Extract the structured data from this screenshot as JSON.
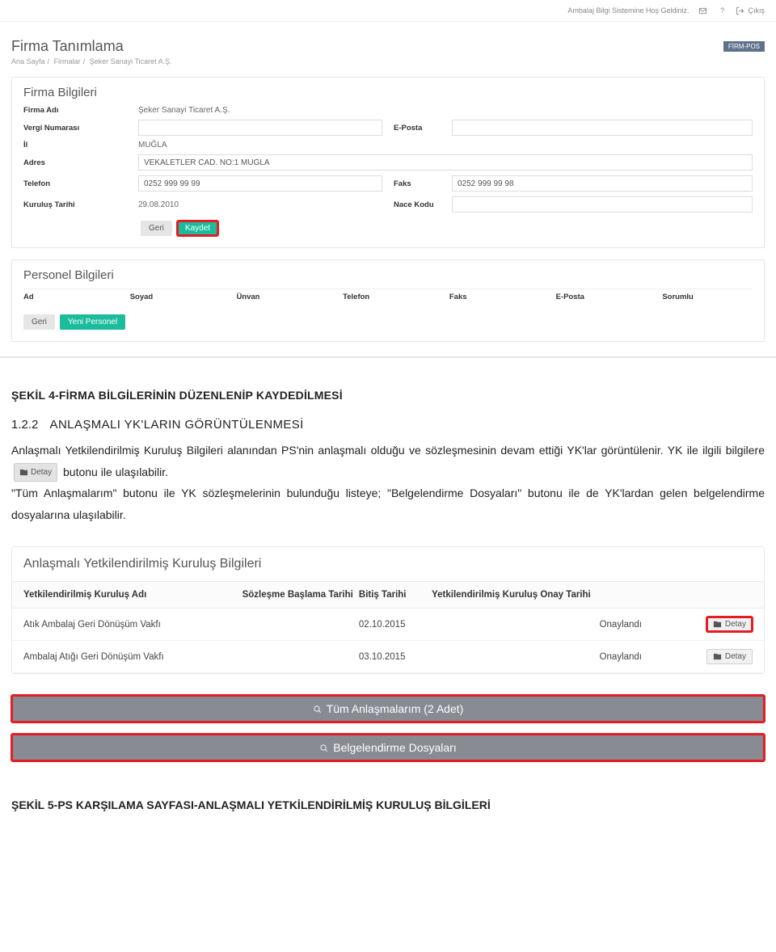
{
  "topbar": {
    "welcome": "Ambalaj Bilgi Sistemine Hoş Geldiniz.",
    "logout": "Çıkış"
  },
  "page": {
    "title": "Firma Tanımlama",
    "breadcrumb": [
      "Ana Sayfa",
      "Firmalar",
      "Şeker Sanayi Ticaret A.Ş."
    ],
    "badge": "FİRM-POS"
  },
  "firm_panel": {
    "title": "Firma Bilgileri",
    "fields": {
      "firma_adi_lbl": "Firma Adı",
      "firma_adi_val": "Şeker Sanayi Ticaret A.Ş.",
      "vergi_lbl": "Vergi Numarası",
      "vergi_val": "",
      "eposta_lbl": "E-Posta",
      "eposta_val": "",
      "il_lbl": "İl",
      "il_val": "MUĞLA",
      "adres_lbl": "Adres",
      "adres_val": "VEKALETLER CAD. NO:1 MUĞLA",
      "telefon_lbl": "Telefon",
      "telefon_val": "0252 999 99 99",
      "faks_lbl": "Faks",
      "faks_val": "0252 999 99 98",
      "kurulus_lbl": "Kuruluş Tarihi",
      "kurulus_val": "29.08.2010",
      "nace_lbl": "Nace Kodu",
      "nace_val": ""
    },
    "buttons": {
      "geri": "Geri",
      "kaydet": "Kaydet"
    }
  },
  "personnel_panel": {
    "title": "Personel Bilgileri",
    "head": {
      "ad": "Ad",
      "soyad": "Soyad",
      "unvan": "Ünvan",
      "telefon": "Telefon",
      "faks": "Faks",
      "eposta": "E-Posta",
      "sorumlu": "Sorumlu"
    },
    "buttons": {
      "geri": "Geri",
      "yeni": "Yeni Personel"
    }
  },
  "captions": {
    "fig4": "ŞEKİL 4-FİRMA BİLGİLERİNİN DÜZENLENİP KAYDEDİLMESİ",
    "fig5": "ŞEKİL 5-PS KARŞILAMA SAYFASI-ANLAŞMALI YETKİLENDİRİLMİŞ KURULUŞ BİLGİLERİ"
  },
  "section": {
    "number": "1.2.2",
    "title": "ANLAŞMALI YK'LARIN GÖRÜNTÜLENMESİ",
    "para_1a": "Anlaşmalı Yetkilendirilmiş Kuruluş Bilgileri alanından PS'nin anlaşmalı olduğu ve sözleşmesinin devam ettiği YK'lar görüntülenir. YK ile ilgili bilgilere",
    "para_1b": "butonu ile ulaşılabilir.",
    "inline_btn": "Detay",
    "para_2": "\"Tüm Anlaşmalarım\" butonu ile YK sözleşmelerinin bulunduğu listeye; \"Belgelendirme Dosyaları\" butonu ile de YK'lardan gelen belgelendirme dosyalarına ulaşılabilir."
  },
  "yk_table": {
    "title": "Anlaşmalı Yetkilendirilmiş Kuruluş Bilgileri",
    "head": {
      "adi": "Yetkilendirilmiş Kuruluş Adı",
      "baslama": "Sözleşme Başlama Tarihi",
      "bitis": "Bitiş Tarihi",
      "onay": "Yetkilendirilmiş Kuruluş Onay Tarihi",
      "status": "",
      "action": ""
    },
    "rows": [
      {
        "adi": "Atık Ambalaj Geri Dönüşüm Vakfı",
        "baslama": "",
        "bitis": "02.10.2015",
        "onay": "",
        "status": "Onaylandı",
        "detay": "Detay"
      },
      {
        "adi": "Ambalaj Atığı Geri Dönüşüm Vakfı",
        "baslama": "",
        "bitis": "03.10.2015",
        "onay": "",
        "status": "Onaylandı",
        "detay": "Detay"
      }
    ],
    "big_buttons": {
      "tum": "Tüm Anlaşmalarım (2 Adet)",
      "belge": "Belgelendirme Dosyaları"
    }
  }
}
